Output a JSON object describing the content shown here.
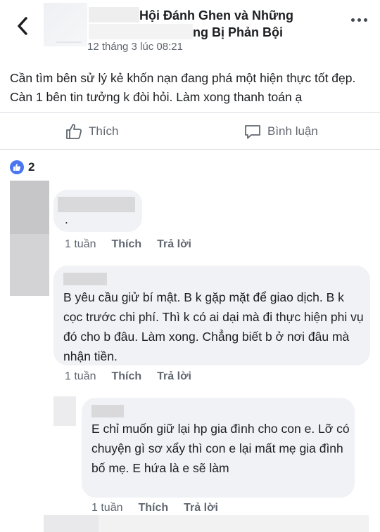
{
  "header": {
    "group_name_line1": "Hội Đánh Ghen và Những",
    "group_name_line2": "ng Bị Phản Bội",
    "timestamp": "12 tháng 3 lúc 08:21"
  },
  "post": {
    "text": "Cần tìm bên sử lý kẻ khốn nạn đang phá một hiện thực tốt đẹp. Càn 1 bên tin tưởng k đòi hỏi. Làm xong thanh toán ạ"
  },
  "actions": {
    "like_label": "Thích",
    "comment_label": "Bình luận"
  },
  "reactions": {
    "count": "2"
  },
  "comments": [
    {
      "text": ".",
      "time": "1 tuần",
      "like_label": "Thích",
      "reply_label": "Trả lời"
    },
    {
      "text": "B yêu cầu giử bí mật. B k gặp mặt để giao dịch. B k cọc trước chi phí. Thì k có ai dại mà đi thực hiện phi vụ đó cho b đâu. Làm xong. Chẳng biết b ở nơi đâu mà nhận tiền.",
      "time": "1 tuần",
      "like_label": "Thích",
      "reply_label": "Trả lời"
    }
  ],
  "reply": {
    "text": "E chỉ muốn giữ lại hp gia đình cho con e. Lỡ có chuyện gì sơ xẩy thì con e lại mất mẹ gia đình bố mẹ. E hứa là e sẽ làm",
    "time": "1 tuần",
    "like_label": "Thích",
    "reply_label": "Trả lời"
  },
  "colors": {
    "bubble": "#f0f2f5",
    "meta_text": "#606770",
    "like_blue": "#4a76f0"
  }
}
